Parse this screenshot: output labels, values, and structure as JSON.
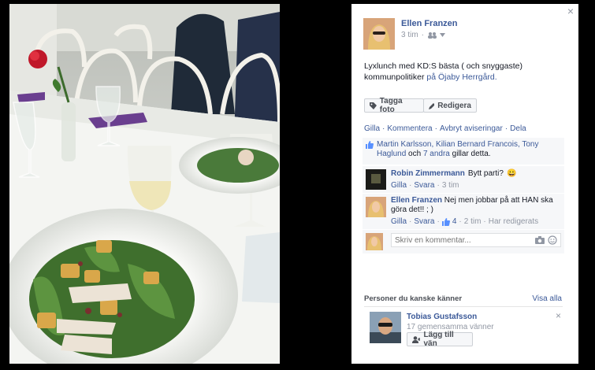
{
  "post": {
    "author": "Ellen Franzen",
    "time": "3 tim",
    "audience_icon": "friends-icon",
    "text": "Lyxlunch med KD:S bästa ( och snyggaste) kommunpolitiker",
    "location_prefix": "på",
    "location": "Öjaby Herrgård."
  },
  "buttons": {
    "tag": "Tagga foto",
    "edit": "Redigera"
  },
  "actions": {
    "like": "Gilla",
    "comment": "Kommentera",
    "unfollow": "Avbryt aviseringar",
    "share": "Dela",
    "sep": "·"
  },
  "likes": {
    "names": "Martin Karlsson, Kilian Bernard Francois, Tony Haglund",
    "and": "och",
    "others": "7 andra",
    "suffix": "gillar detta."
  },
  "comments": [
    {
      "author": "Robin Zimmermann",
      "text": "Bytt parti?",
      "emoji": "😀",
      "like": "Gilla",
      "reply": "Svara",
      "time": "3 tim"
    },
    {
      "author": "Ellen Franzen",
      "text": "Nej men jobbar på att HAN ska göra det!! ; )",
      "like": "Gilla",
      "reply": "Svara",
      "likes": "4",
      "time": "2 tim",
      "edited": "Har redigerats"
    }
  ],
  "comment_input": {
    "placeholder": "Skriv en kommentar..."
  },
  "suggestions": {
    "title": "Personer du kanske känner",
    "see_all": "Visa alla",
    "person": {
      "name": "Tobias Gustafsson",
      "mutual": "17 gemensamma vänner",
      "add": "Lägg till vän"
    }
  },
  "close": "×",
  "colors": {
    "link": "#3b5998",
    "panel_bg": "#ffffff",
    "comment_bg": "#f6f7f9",
    "backdrop": "#000000"
  }
}
